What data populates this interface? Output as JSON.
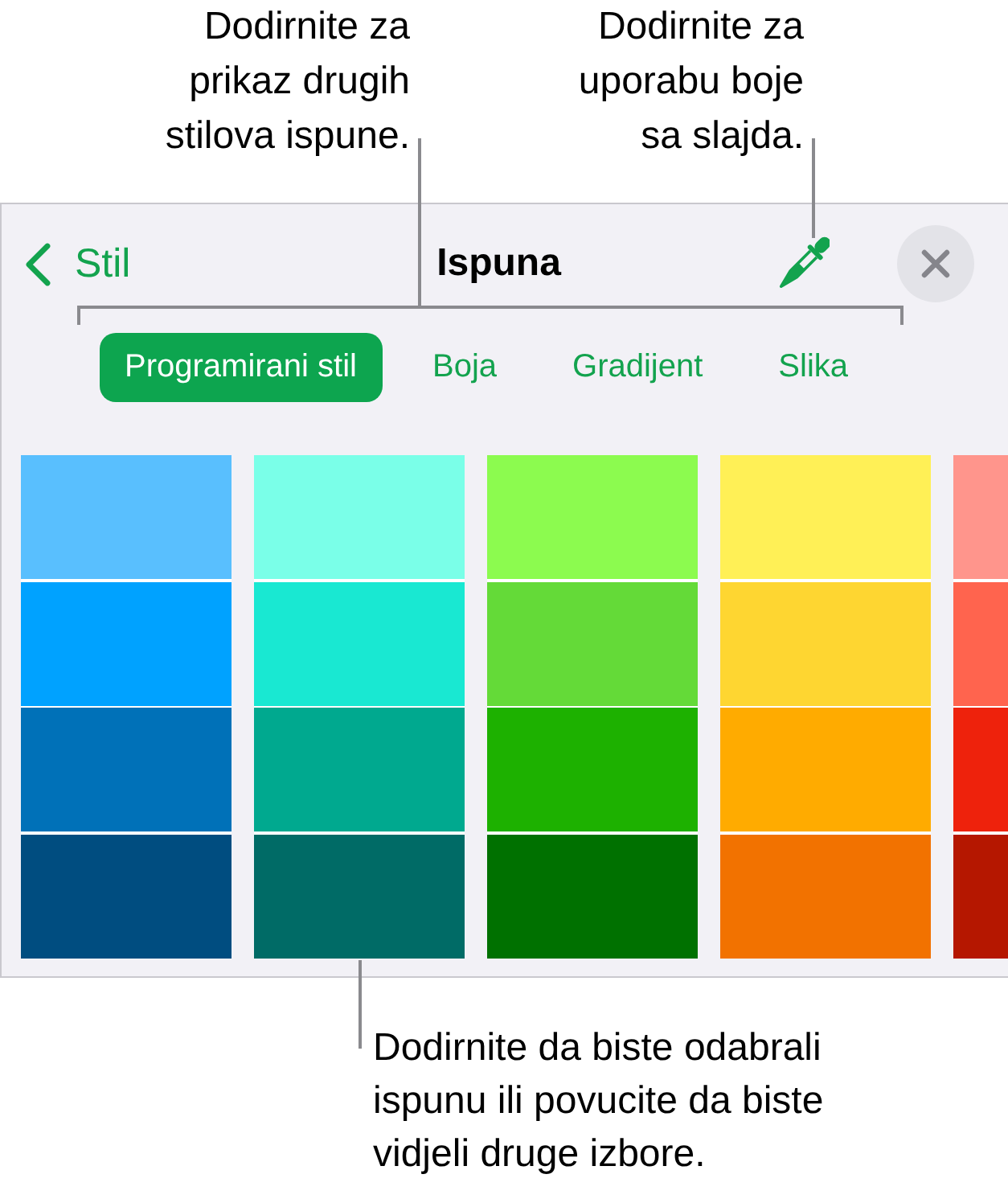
{
  "callouts_top": [
    {
      "text": "Dodirnite za\nprikaz drugih\nstilova ispune."
    },
    {
      "text": "Dodirnite za\nuporabu boje\nsa slajda."
    }
  ],
  "panel": {
    "back_button": {
      "label": "Stil"
    },
    "title": "Ispuna",
    "tabs": [
      {
        "label": "Programirani stil",
        "selected": true
      },
      {
        "label": "Boja",
        "selected": false
      },
      {
        "label": "Gradijent",
        "selected": false
      },
      {
        "label": "Slika",
        "selected": false
      }
    ],
    "swatch_columns": [
      {
        "swatches": [
          {
            "color": "#59bffe"
          },
          {
            "color": "#00a2ff"
          },
          {
            "color": "#0071b8"
          },
          {
            "color": "#004d80"
          }
        ]
      },
      {
        "swatches": [
          {
            "color": "#7affe8"
          },
          {
            "color": "#19e8d2"
          },
          {
            "color": "#00a98f"
          },
          {
            "color": "#006b66"
          }
        ]
      },
      {
        "swatches": [
          {
            "color": "#8cfb4f"
          },
          {
            "color": "#64da38"
          },
          {
            "color": "#1db100"
          },
          {
            "color": "#007100"
          }
        ]
      },
      {
        "swatches": [
          {
            "color": "#fff056"
          },
          {
            "color": "#fed631"
          },
          {
            "color": "#ffab00"
          },
          {
            "color": "#f27200"
          }
        ]
      },
      {
        "swatches": [
          {
            "color": "#ff958c"
          },
          {
            "color": "#ff644e"
          },
          {
            "color": "#ee220c"
          },
          {
            "color": "#b51700"
          }
        ]
      }
    ]
  },
  "callout_bottom": {
    "text": "Dodirnite da biste odabrali\nispunu ili povucite da biste\nvidjeli druge izbore."
  }
}
